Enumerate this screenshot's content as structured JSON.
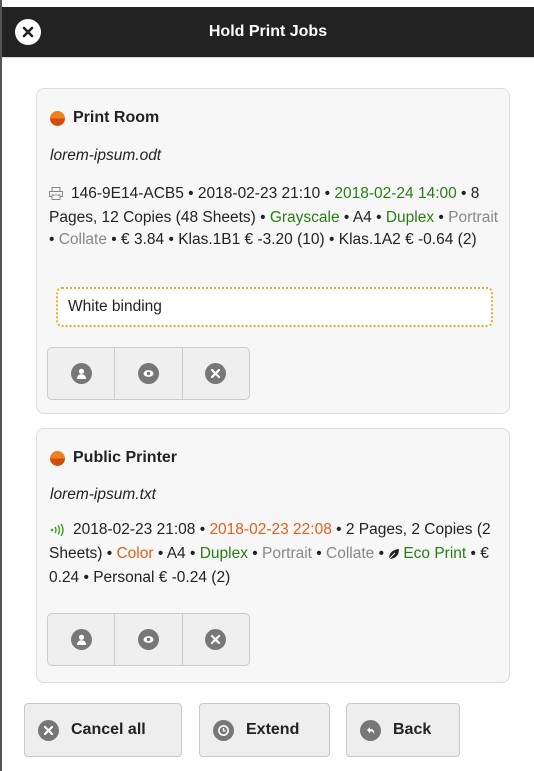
{
  "header": {
    "title": "Hold Print Jobs"
  },
  "jobs": [
    {
      "printer": "Print Room",
      "document": "lorem-ipsum.odt",
      "job_id": "146-9E14-ACB5",
      "submitted": "2018-02-23 21:10",
      "expires": "2018-02-24 14:00",
      "pages": "8 Pages, 12 Copies (48 Sheets)",
      "color": "Grayscale",
      "paper": "A4",
      "duplex": "Duplex",
      "orientation": "Portrait",
      "collate": "Collate",
      "cost": "€ 3.84",
      "account_1": "Klas.1B1",
      "account_1_amount": "€ -3.20 (10)",
      "account_2": "Klas.1A2",
      "account_2_amount": "€ -0.64 (2)",
      "comment": "White binding"
    },
    {
      "printer": "Public Printer",
      "document": "lorem-ipsum.txt",
      "submitted": "2018-02-23 21:08",
      "expires": "2018-02-23 22:08",
      "pages": "2 Pages,",
      "copies": "2 Copies (2 Sheets)",
      "color": "Color",
      "paper": "A4",
      "duplex": "Duplex",
      "orientation": "Portrait",
      "collate": "Collate",
      "eco": "Eco Print",
      "cost": "€ 0.24",
      "account_1": "Personal",
      "account_1_amount": "€ -0.24 (2)"
    }
  ],
  "footer": {
    "cancel_all": "Cancel all",
    "extend": "Extend",
    "back": "Back"
  },
  "icons": {
    "close": "close-icon",
    "status": "status-dot-icon",
    "printer": "printer-icon",
    "wireless": "wireless-print-icon",
    "user": "user-icon",
    "preview": "eye-icon",
    "delete": "delete-icon",
    "eco": "leaf-icon",
    "clock": "clock-icon",
    "back": "back-icon"
  },
  "colors": {
    "header_bg": "#222222",
    "green": "#2a7d16",
    "orange": "#e0601d",
    "muted": "#888888",
    "comment_border": "#f0a92c"
  }
}
